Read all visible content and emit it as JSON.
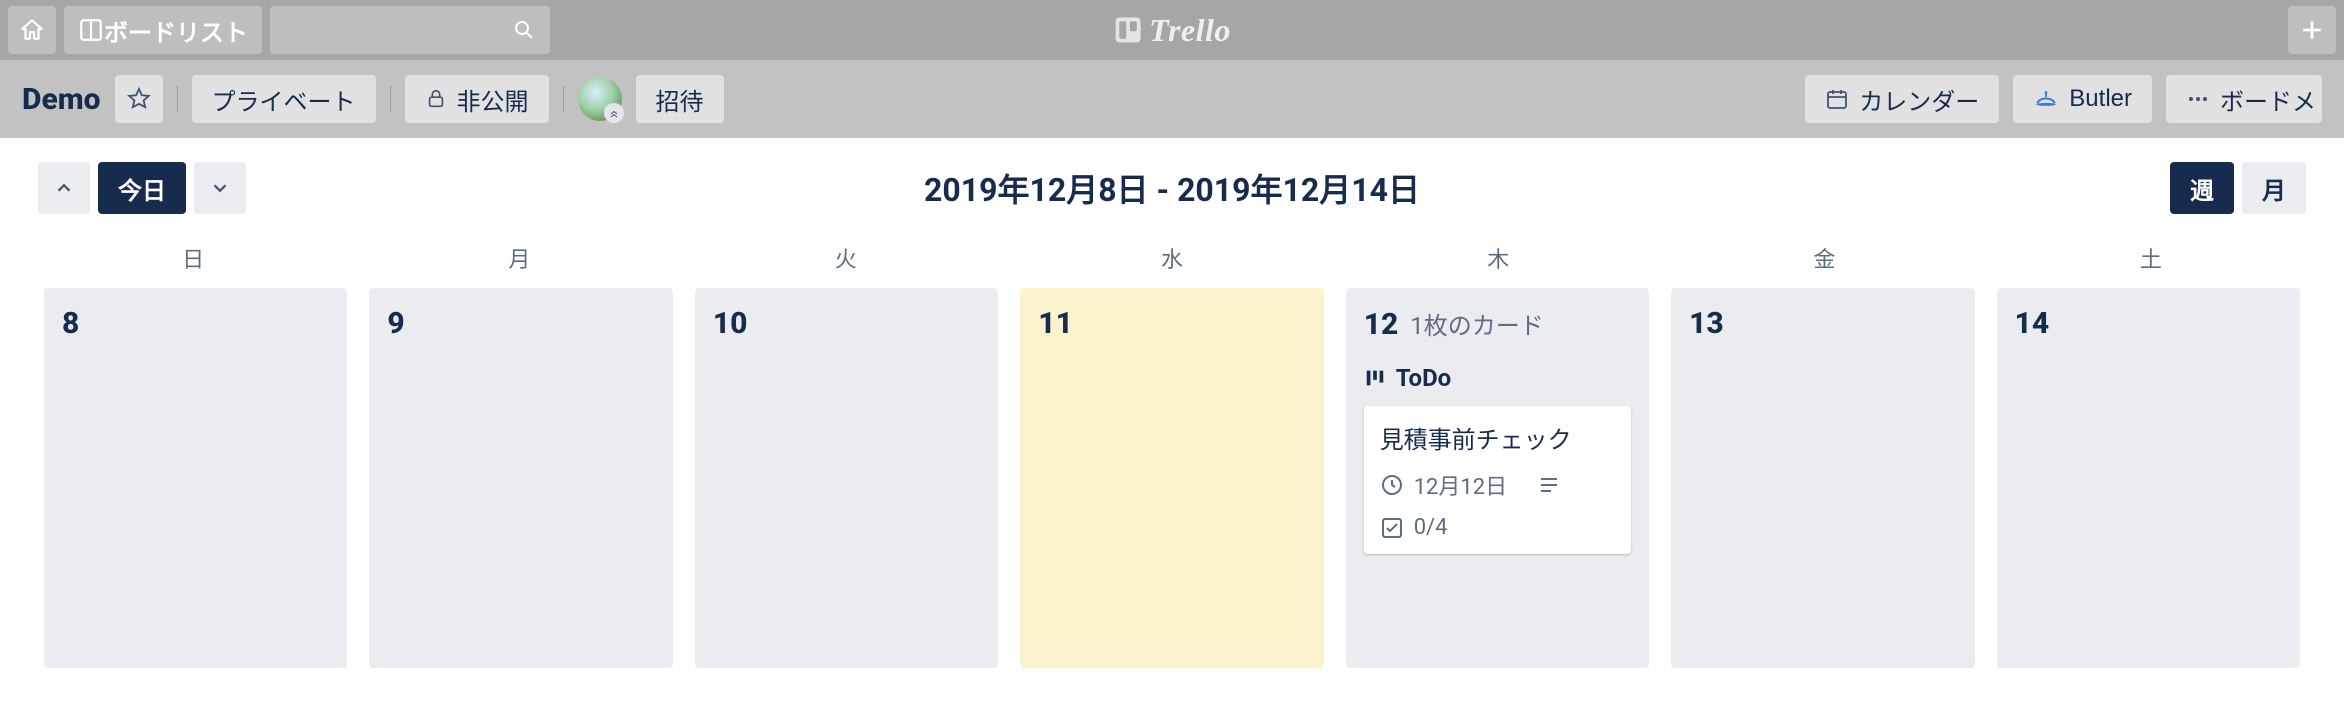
{
  "nav": {
    "boards_label": "ボードリスト"
  },
  "logo": {
    "text": "Trello"
  },
  "board": {
    "title": "Demo",
    "privacy_label": "プライベート",
    "visibility_label": "非公開",
    "invite_label": "招待",
    "calendar_btn": "カレンダー",
    "butler_btn": "Butler",
    "menu_btn": "ボードメ"
  },
  "calendar": {
    "today_label": "今日",
    "title": "2019年12月8日 - 2019年12月14日",
    "week_label": "週",
    "month_label": "月",
    "dow": [
      "日",
      "月",
      "火",
      "水",
      "木",
      "金",
      "土"
    ],
    "days": [
      {
        "num": "8",
        "today": false,
        "count": "",
        "lists": []
      },
      {
        "num": "9",
        "today": false,
        "count": "",
        "lists": []
      },
      {
        "num": "10",
        "today": false,
        "count": "",
        "lists": []
      },
      {
        "num": "11",
        "today": true,
        "count": "",
        "lists": []
      },
      {
        "num": "12",
        "today": false,
        "count": "1枚のカード",
        "lists": [
          {
            "name": "ToDo",
            "cards": [
              {
                "title": "見積事前チェック",
                "due": "12月12日",
                "has_desc": true,
                "checklist": "0/4"
              }
            ]
          }
        ]
      },
      {
        "num": "13",
        "today": false,
        "count": "",
        "lists": []
      },
      {
        "num": "14",
        "today": false,
        "count": "",
        "lists": []
      }
    ]
  }
}
